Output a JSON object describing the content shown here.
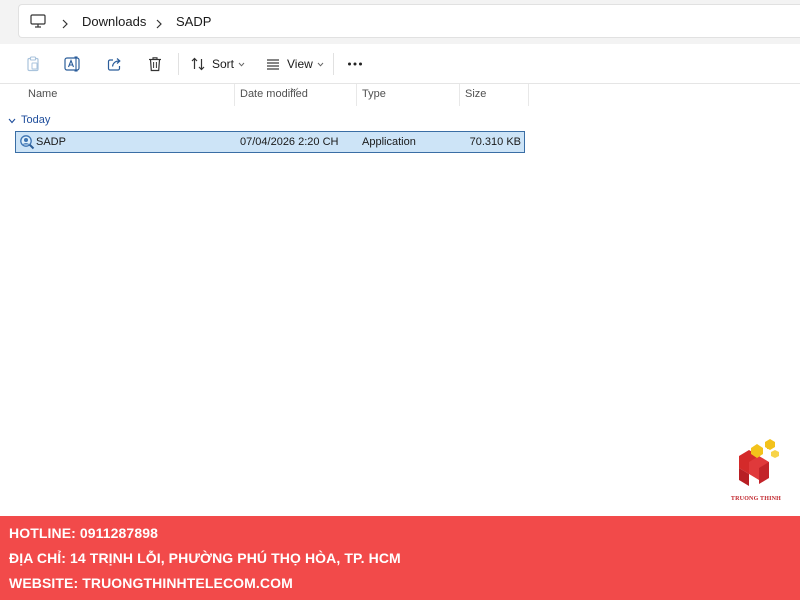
{
  "address_bar": {
    "root_icon": "this-pc-icon",
    "breadcrumbs": [
      "Downloads",
      "SADP"
    ]
  },
  "command_bar": {
    "buttons": [
      {
        "icon": "paste-icon",
        "enabled": false
      },
      {
        "icon": "rename-icon",
        "enabled": true
      },
      {
        "icon": "share-icon",
        "enabled": true
      },
      {
        "icon": "delete-icon",
        "enabled": true
      }
    ],
    "sort_label": "Sort",
    "view_label": "View",
    "more_icon": "more-icon"
  },
  "columns": {
    "name": "Name",
    "date_modified": "Date modified",
    "type": "Type",
    "size": "Size"
  },
  "groups": [
    {
      "label": "Today",
      "files": [
        {
          "name": "SADP",
          "icon": "sadp-app-icon",
          "date_modified": "07/04/2026 2:20 CH",
          "type": "Application",
          "size": "70.310 KB",
          "selected": true
        }
      ]
    }
  ],
  "watermark": {
    "logo_text": "TRUONG THINH",
    "colors": {
      "red": "#d42a2a",
      "yellow": "#f3c21b"
    }
  },
  "banner": {
    "color": "#f24a4a",
    "hotline": "HOTLINE: 0911287898",
    "address": "ĐỊA CHỈ: 14 TRỊNH LỖI, PHƯỜNG PHÚ THỌ HÒA, TP. HCM",
    "website": "WEBSITE: TRUONGTHINHTELECOM.COM"
  }
}
